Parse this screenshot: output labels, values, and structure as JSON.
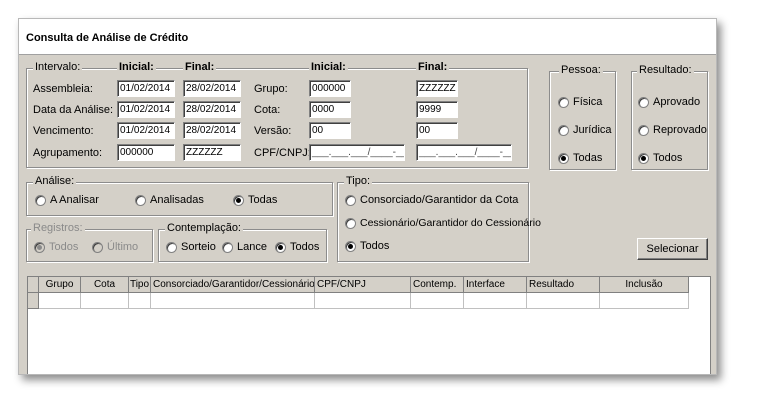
{
  "window": {
    "title": "Consulta de Análise de Crédito"
  },
  "intervalo": {
    "group_label": "Intervalo:",
    "inicial_label": "Inicial:",
    "final_label": "Final:",
    "assembleia": {
      "label": "Assembleia:",
      "inicial": "01/02/2014",
      "final": "28/02/2014"
    },
    "data_analise": {
      "label": "Data da Análise:",
      "inicial": "01/02/2014",
      "final": "28/02/2014"
    },
    "vencimento": {
      "label": "Vencimento:",
      "inicial": "01/02/2014",
      "final": "28/02/2014"
    },
    "agrupamento": {
      "label": "Agrupamento:",
      "inicial": "000000",
      "final": "ZZZZZZ"
    },
    "grupo_inicial_label": "Inicial:",
    "grupo_final_label": "Final:",
    "grupo": {
      "label": "Grupo:",
      "inicial": "000000",
      "final": "ZZZZZZ"
    },
    "cota": {
      "label": "Cota:",
      "inicial": "0000",
      "final": "9999"
    },
    "versao": {
      "label": "Versão:",
      "inicial": "00",
      "final": "00"
    },
    "cpf": {
      "label": "CPF/CNPJ:",
      "inicial": "___.___.___/____-__",
      "final": "___.___.___/____-__"
    }
  },
  "pessoa": {
    "label": "Pessoa:",
    "options": [
      "Física",
      "Jurídica",
      "Todas"
    ],
    "selected": "Todas"
  },
  "resultado": {
    "label": "Resultado:",
    "options": [
      "Aprovado",
      "Reprovado",
      "Todos"
    ],
    "selected": "Todos"
  },
  "analise": {
    "label": "Análise:",
    "options": [
      "A Analisar",
      "Analisadas",
      "Todas"
    ],
    "selected": "Todas"
  },
  "tipo": {
    "label": "Tipo:",
    "options": [
      "Consorciado/Garantidor da Cota",
      "Cessionário/Garantidor do Cessionário",
      "Todos"
    ],
    "selected": "Todos"
  },
  "registros": {
    "label": "Registros:",
    "options": [
      "Todos",
      "Último"
    ],
    "selected": "Todos",
    "disabled": true
  },
  "contemplacao": {
    "label": "Contemplação:",
    "options": [
      "Sorteio",
      "Lance",
      "Todos"
    ],
    "selected": "Todos"
  },
  "actions": {
    "selecionar_label": "Selecionar"
  },
  "grid": {
    "columns": [
      "Grupo",
      "Cota",
      "Tipo",
      "Consorciado/Garantidor/Cessionário",
      "CPF/CNPJ",
      "Contemp.",
      "Interface",
      "Resultado",
      "Inclusão"
    ]
  }
}
